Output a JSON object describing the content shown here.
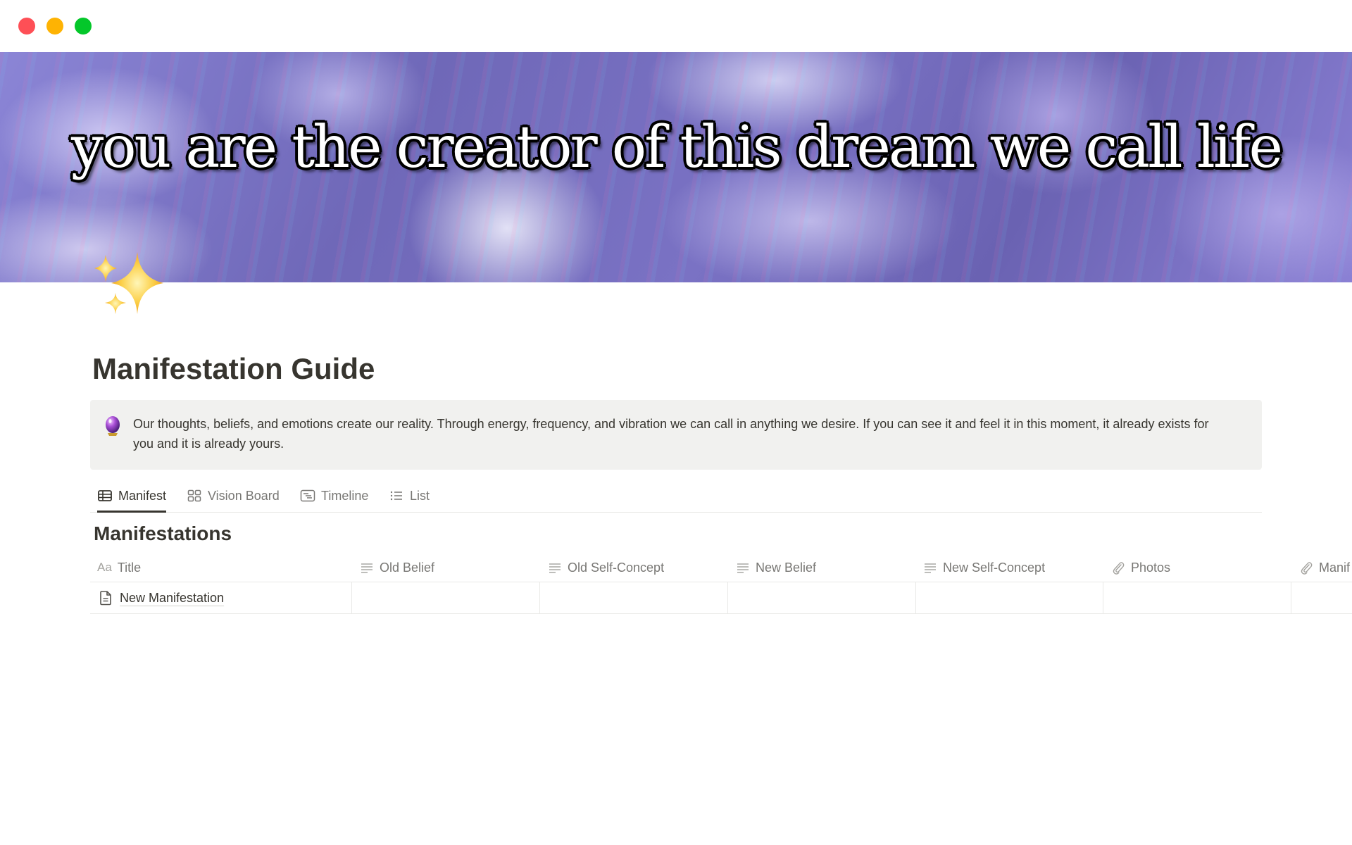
{
  "window": {
    "controls": [
      "close",
      "minimize",
      "maximize"
    ]
  },
  "banner": {
    "text": "you are the creator of this dream we call life"
  },
  "page": {
    "icon": "sparkles-icon",
    "title": "Manifestation Guide"
  },
  "callout": {
    "icon": "crystal-ball-icon",
    "text": "Our thoughts, beliefs, and emotions create our reality. Through energy, frequency, and vibration we can call in anything we desire. If you can see it and feel it in this moment, it already exists for you and it is already yours."
  },
  "views": {
    "tabs": [
      {
        "label": "Manifest",
        "icon": "table-icon",
        "active": true
      },
      {
        "label": "Vision Board",
        "icon": "gallery-icon",
        "active": false
      },
      {
        "label": "Timeline",
        "icon": "timeline-icon",
        "active": false
      },
      {
        "label": "List",
        "icon": "list-icon",
        "active": false
      }
    ]
  },
  "database": {
    "title": "Manifestations",
    "columns": [
      {
        "label": "Title",
        "icon": "Aa"
      },
      {
        "label": "Old Belief",
        "icon": "text-lines-icon"
      },
      {
        "label": "Old Self-Concept",
        "icon": "text-lines-icon"
      },
      {
        "label": "New Belief",
        "icon": "text-lines-icon"
      },
      {
        "label": "New Self-Concept",
        "icon": "text-lines-icon"
      },
      {
        "label": "Photos",
        "icon": "paperclip-icon"
      },
      {
        "label": "Manif",
        "icon": "paperclip-icon"
      }
    ],
    "rows": [
      {
        "title": "New Manifestation",
        "icon": "page-icon",
        "cells": [
          "",
          "",
          "",
          "",
          "",
          ""
        ]
      }
    ]
  }
}
